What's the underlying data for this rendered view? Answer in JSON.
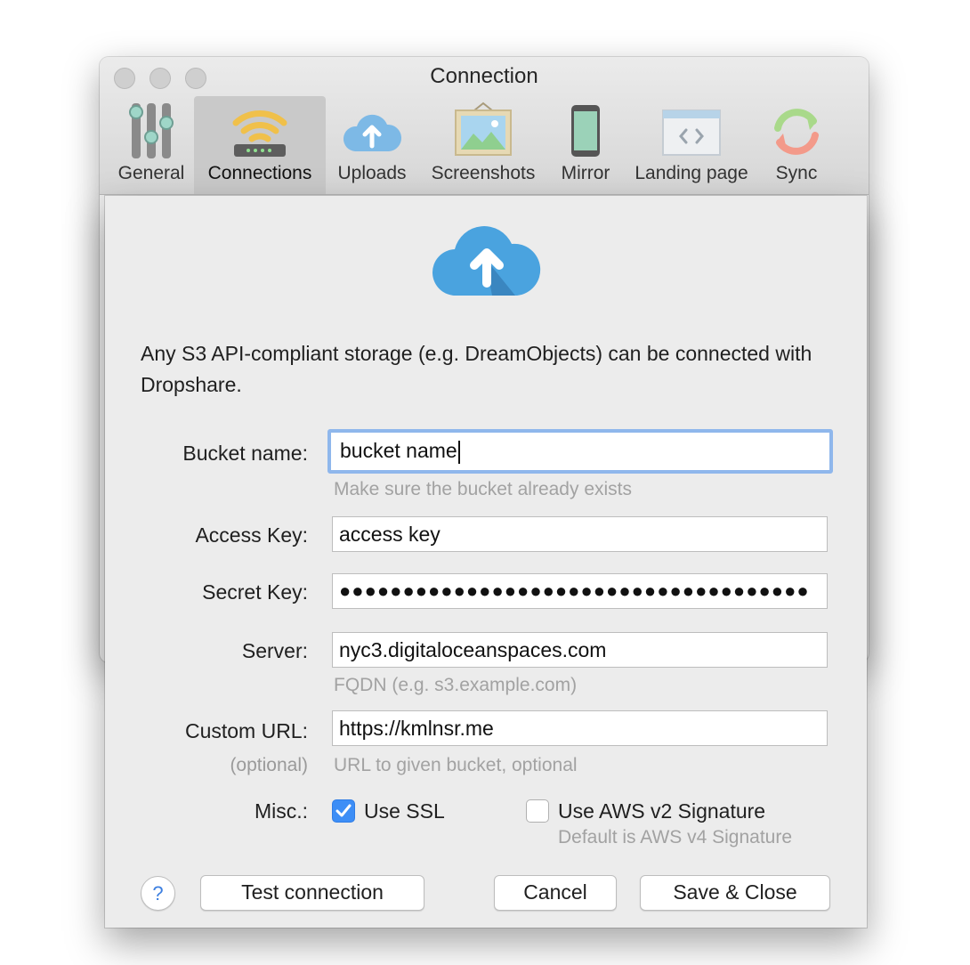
{
  "window": {
    "title": "Connection"
  },
  "toolbar": {
    "items": [
      {
        "label": "General",
        "icon": "sliders-icon"
      },
      {
        "label": "Connections",
        "icon": "router-wifi-icon",
        "active": true
      },
      {
        "label": "Uploads",
        "icon": "cloud-upload-icon"
      },
      {
        "label": "Screenshots",
        "icon": "picture-frame-icon"
      },
      {
        "label": "Mirror",
        "icon": "phone-icon"
      },
      {
        "label": "Landing page",
        "icon": "browser-code-icon"
      },
      {
        "label": "Sync",
        "icon": "sync-arrows-icon"
      }
    ]
  },
  "sheet": {
    "description": "Any S3 API-compliant storage (e.g. DreamObjects) can be connected with Dropshare.",
    "bucket": {
      "label": "Bucket name:",
      "value": "bucket name",
      "hint": "Make sure the bucket already exists"
    },
    "access_key": {
      "label": "Access Key:",
      "value": "access key"
    },
    "secret_key": {
      "label": "Secret Key:",
      "value": "●●●●●●●●●●●●●●●●●●●●●●●●●●●●●●●●●●●●●"
    },
    "server": {
      "label": "Server:",
      "value": "nyc3.digitaloceanspaces.com",
      "hint": "FQDN (e.g. s3.example.com)"
    },
    "custom_url": {
      "label": "Custom URL:",
      "sublabel": "(optional)",
      "value": "https://kmlnsr.me",
      "hint": "URL to given bucket, optional"
    },
    "misc": {
      "label": "Misc.:",
      "use_ssl": {
        "label": "Use SSL",
        "checked": true
      },
      "aws_v2": {
        "label": "Use AWS v2 Signature",
        "checked": false,
        "hint": "Default is AWS v4 Signature"
      }
    },
    "buttons": {
      "help": "?",
      "test": "Test connection",
      "cancel": "Cancel",
      "save": "Save & Close"
    }
  },
  "colors": {
    "accent": "#3d8ef6",
    "focus_ring": "#8fb7ec",
    "cloud": "#4aa3df"
  }
}
